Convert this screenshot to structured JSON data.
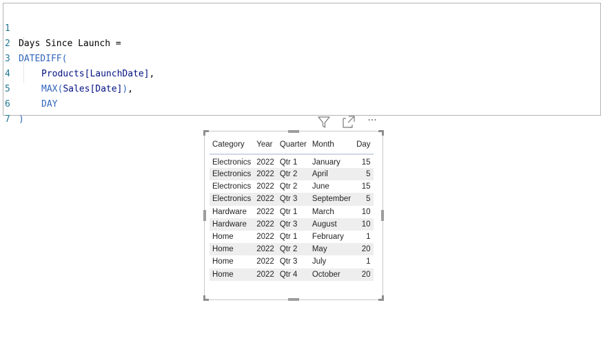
{
  "editor": {
    "lines": [
      {
        "num": "1",
        "text": "Days Since Launch ="
      },
      {
        "num": "2",
        "text": "DATEDIFF("
      },
      {
        "num": "3",
        "text": "Products[LaunchDate],"
      },
      {
        "num": "4",
        "text": "MAX(Sales[Date]),"
      },
      {
        "num": "5",
        "text": "DAY"
      },
      {
        "num": "6",
        "text": ")"
      },
      {
        "num": "7",
        "text": ""
      }
    ],
    "tokens": {
      "measure_name": "Days Since Launch =",
      "datediff": "DATEDIFF(",
      "table1": "Products",
      "col1": "[LaunchDate]",
      "comma": ",",
      "max": "MAX(",
      "table2": "Sales",
      "col2": "[Date]",
      "close_paren": ")",
      "day": "DAY",
      "final_paren": ")"
    }
  },
  "visual_header": {
    "icons": [
      "filter-icon",
      "focus-mode-icon",
      "more-options-icon"
    ],
    "more_label": "···"
  },
  "table": {
    "columns": [
      "Category",
      "Year",
      "Quarter",
      "Month",
      "Day"
    ],
    "rows": [
      [
        "Electronics",
        "2022",
        "Qtr 1",
        "January",
        "15"
      ],
      [
        "Electronics",
        "2022",
        "Qtr 2",
        "April",
        "5"
      ],
      [
        "Electronics",
        "2022",
        "Qtr 2",
        "June",
        "15"
      ],
      [
        "Electronics",
        "2022",
        "Qtr 3",
        "September",
        "5"
      ],
      [
        "Hardware",
        "2022",
        "Qtr 1",
        "March",
        "10"
      ],
      [
        "Hardware",
        "2022",
        "Qtr 3",
        "August",
        "10"
      ],
      [
        "Home",
        "2022",
        "Qtr 1",
        "February",
        "1"
      ],
      [
        "Home",
        "2022",
        "Qtr 2",
        "May",
        "20"
      ],
      [
        "Home",
        "2022",
        "Qtr 3",
        "July",
        "1"
      ],
      [
        "Home",
        "2022",
        "Qtr 4",
        "October",
        "20"
      ]
    ]
  },
  "colors": {
    "line_number": "#237893",
    "function": "#3165bb",
    "column_ref": "#001080",
    "row_alt": "#eeeeee",
    "header_rule": "#cfd7e6"
  }
}
